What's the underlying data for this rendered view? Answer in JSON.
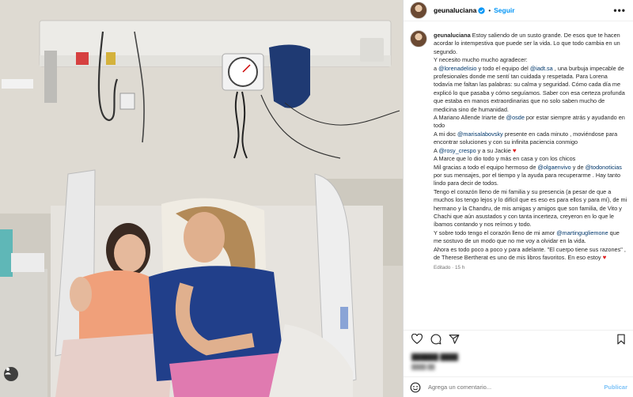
{
  "post": {
    "username": "geunaluciana",
    "follow_label": "Seguir",
    "more_label": "•••",
    "separator": "•"
  },
  "caption": {
    "username": "geunaluciana",
    "lines": [
      {
        "t": "Estoy saliendo de un susto grande. De esos que te hacen acordar lo intempestiva que puede ser la vida. Lo que todo cambia en un segundo."
      },
      {
        "t": "Y necesito mucho mucho agradecer:"
      },
      {
        "pre": "a ",
        "m1": "@lorenadelisio",
        "mid": " y todo el equipo del ",
        "m2": "@iadt.sa",
        "post": " , una burbuja impecable de profesionales donde me sentí tan cuidada y respetada. Para Lorena todavía me faltan las palabras: su calma y seguridad. Cómo cada día me explicó lo que pasaba y cómo seguíamos. Saber con esa certeza profunda que estaba en manos extraordinarias que no solo saben mucho de medicina sino de humanidad."
      },
      {
        "pre": "A Mariano Allende Iriarte de ",
        "m1": "@osde",
        "post": " por estar siempre atrás y ayudando en todo"
      },
      {
        "pre": "A mi doc ",
        "m1": "@marisalabovsky",
        "post": " presente en cada minuto , moviéndose para encontrar soluciones y con su infinita paciencia conmigo"
      },
      {
        "pre": "A ",
        "m1": "@rosy_crespo",
        "post": " y a su Jackie ",
        "heart": "♥"
      },
      {
        "t": "A Marce que lo dio todo y más en casa y con los chicos"
      },
      {
        "pre": "Mil gracias a todo el equipo hermoso de ",
        "m1": "@olgaenvivo",
        "mid": " y de ",
        "m2": "@todonoticias",
        "post": " por sus mensajes, por el tiempo y la ayuda para recuperarme . Hay tanto lindo para decir de todos."
      },
      {
        "t": "Tengo el corazón lleno de mi familia y su presencia (a pesar de que a muchos los tengo lejos y lo difícil que es eso es para ellos y para mí), de mi hermano y la Chandru, de mis amigas y amigos que son familia, de Vito y Chachi que aún asustados y con tanta incerteza, creyeron en lo que le íbamos contando y nos reímos y todo."
      },
      {
        "pre": "Y sobre todo tengo el corazón lleno de mi amor ",
        "m1": "@martingugliemone",
        "post": " que me sostuvo de un modo que no me voy a olvidar en la vida."
      },
      {
        "t": "Ahora es todo poco a poco y para adelante. \"El cuerpo tiene sus razones\" , de Therese Bertherat es uno de mis libros favoritos. En eso estoy ",
        "heart": "♥"
      }
    ],
    "edited": "Editado · 15 h"
  },
  "comment": {
    "placeholder": "Agrega un comentario...",
    "publish_label": "Publicar"
  },
  "colors": {
    "accent": "#0095f6",
    "mention": "#00376b",
    "muted": "#737373",
    "heart": "#e02020"
  },
  "icons": [
    "verified-badge-icon",
    "heart-icon",
    "comment-icon",
    "share-icon",
    "save-icon",
    "emoji-icon",
    "tag-user-icon"
  ]
}
